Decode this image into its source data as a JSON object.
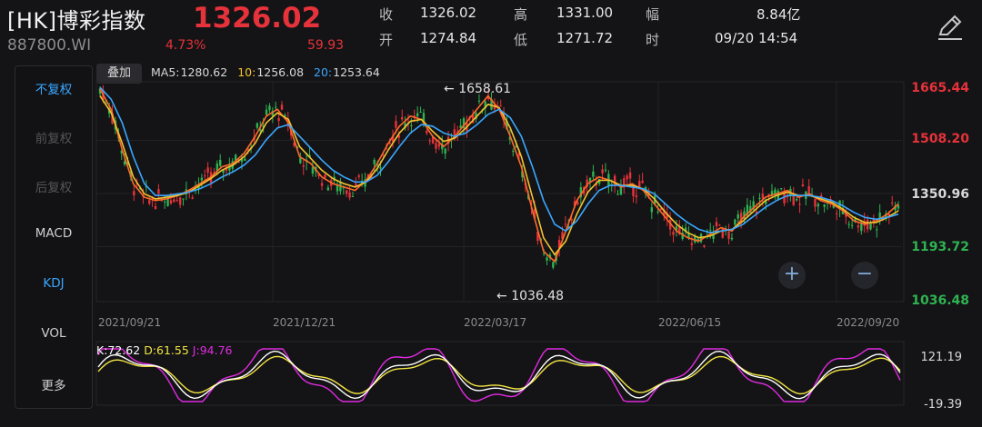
{
  "header": {
    "title": "[HK]博彩指数",
    "code": "887800.WI",
    "price": "1326.02",
    "change_pct": "4.73%",
    "change": "59.93",
    "stats": [
      {
        "label": "收",
        "value": "1326.02"
      },
      {
        "label": "高",
        "value": "1331.00"
      },
      {
        "label": "幅",
        "value": "8.84亿"
      },
      {
        "label": "开",
        "value": "1274.84"
      },
      {
        "label": "低",
        "value": "1271.72"
      },
      {
        "label": "时",
        "value": "09/20 14:54"
      }
    ]
  },
  "sidebar": {
    "items": [
      "不复权",
      "前复权",
      "后复权",
      "MACD",
      "KDJ",
      "VOL",
      "更多"
    ]
  },
  "overlay_label": "叠加",
  "ma": {
    "ma5_label": "MA5:",
    "ma5_value": "1280.62",
    "ma10_label": "10:",
    "ma10_value": "1256.08",
    "ma20_label": "20:",
    "ma20_value": "1253.64"
  },
  "colors": {
    "up": "#e6323a",
    "down": "#2fb352",
    "ma5": "#ff6a2a",
    "ma10": "#f2c230",
    "ma20": "#3aa6ff",
    "k": "#ffffff",
    "d": "#f2e443",
    "j": "#e02be0",
    "accent": "#3aa6ff"
  },
  "price_axis": {
    "labels": [
      "1665.44",
      "1508.20",
      "1350.96",
      "1193.72",
      "1036.48"
    ]
  },
  "date_axis": [
    "2021/09/21",
    "2021/12/21",
    "2022/03/17",
    "2022/06/15",
    "2022/09/20"
  ],
  "annotations": {
    "high": "1658.61",
    "low": "1036.48"
  },
  "kdj": {
    "k_label": "K:72.62",
    "d_label": "D:61.55",
    "j_label": "J:94.76",
    "axis_top": "121.19",
    "axis_bottom": "-19.39"
  },
  "chart_data": {
    "type": "line",
    "series": [
      {
        "name": "MA5",
        "y": [
          1660,
          1600,
          1480,
          1380,
          1340,
          1330,
          1335,
          1345,
          1360,
          1380,
          1400,
          1430,
          1440,
          1470,
          1520,
          1580,
          1600,
          1560,
          1460,
          1440,
          1400,
          1380,
          1370,
          1360,
          1390,
          1440,
          1500,
          1550,
          1580,
          1570,
          1520,
          1490,
          1520,
          1560,
          1600,
          1640,
          1600,
          1520,
          1430,
          1300,
          1180,
          1150,
          1240,
          1330,
          1380,
          1400,
          1390,
          1370,
          1380,
          1360,
          1320,
          1280,
          1240,
          1220,
          1210,
          1230,
          1250,
          1240,
          1280,
          1310,
          1340,
          1350,
          1360,
          1340,
          1350,
          1330,
          1320,
          1300,
          1270,
          1260,
          1270,
          1290,
          1320
        ]
      },
      {
        "name": "MA10",
        "y": [
          1640,
          1590,
          1500,
          1400,
          1350,
          1335,
          1340,
          1345,
          1355,
          1375,
          1395,
          1420,
          1435,
          1460,
          1500,
          1560,
          1590,
          1570,
          1490,
          1455,
          1420,
          1395,
          1380,
          1370,
          1385,
          1425,
          1480,
          1530,
          1565,
          1570,
          1535,
          1505,
          1515,
          1545,
          1580,
          1615,
          1605,
          1545,
          1460,
          1340,
          1220,
          1170,
          1210,
          1290,
          1355,
          1390,
          1390,
          1375,
          1375,
          1365,
          1335,
          1295,
          1260,
          1235,
          1220,
          1225,
          1240,
          1245,
          1270,
          1300,
          1330,
          1345,
          1355,
          1345,
          1345,
          1335,
          1325,
          1305,
          1280,
          1265,
          1265,
          1280,
          1300
        ]
      },
      {
        "name": "MA20",
        "y": [
          1665,
          1630,
          1560,
          1460,
          1380,
          1345,
          1345,
          1350,
          1355,
          1365,
          1380,
          1400,
          1415,
          1435,
          1465,
          1510,
          1545,
          1555,
          1520,
          1485,
          1450,
          1420,
          1400,
          1385,
          1385,
          1405,
          1445,
          1490,
          1530,
          1555,
          1550,
          1530,
          1520,
          1530,
          1555,
          1585,
          1600,
          1575,
          1520,
          1430,
          1330,
          1260,
          1240,
          1270,
          1320,
          1360,
          1375,
          1375,
          1370,
          1365,
          1350,
          1320,
          1290,
          1265,
          1245,
          1235,
          1240,
          1245,
          1260,
          1285,
          1310,
          1330,
          1345,
          1345,
          1345,
          1340,
          1330,
          1315,
          1295,
          1280,
          1275,
          1280,
          1290
        ]
      }
    ],
    "ylim": [
      1036.48,
      1665.44
    ]
  }
}
